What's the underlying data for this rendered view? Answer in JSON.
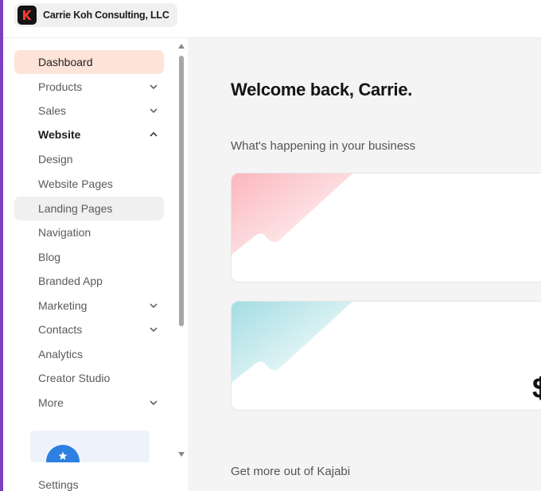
{
  "app": {
    "org_name": "Carrie Koh Consulting, LLC",
    "accent_color": "#7b3fc1",
    "logo_icon": "kajabi-k-logo"
  },
  "sidebar": {
    "items": [
      {
        "label": "Dashboard",
        "state": "active"
      },
      {
        "label": "Products",
        "chevron": "down"
      },
      {
        "label": "Sales",
        "chevron": "down"
      },
      {
        "label": "Website",
        "chevron": "up",
        "expanded": true
      },
      {
        "label": "Design"
      },
      {
        "label": "Website Pages"
      },
      {
        "label": "Landing Pages",
        "state": "hover"
      },
      {
        "label": "Navigation"
      },
      {
        "label": "Blog"
      },
      {
        "label": "Branded App"
      },
      {
        "label": "Marketing",
        "chevron": "down"
      },
      {
        "label": "Contacts",
        "chevron": "down"
      },
      {
        "label": "Analytics"
      },
      {
        "label": "Creator Studio"
      },
      {
        "label": "More",
        "chevron": "down"
      }
    ],
    "settings_label": "Settings"
  },
  "main": {
    "welcome": "Welcome back, Carrie.",
    "happening_label": "What's happening in your business",
    "cards": [
      {
        "accent": "#f7a8b0",
        "glyph": ""
      },
      {
        "accent": "#a3dde3",
        "glyph": "$"
      }
    ],
    "get_more_label": "Get more out of Kajabi"
  }
}
